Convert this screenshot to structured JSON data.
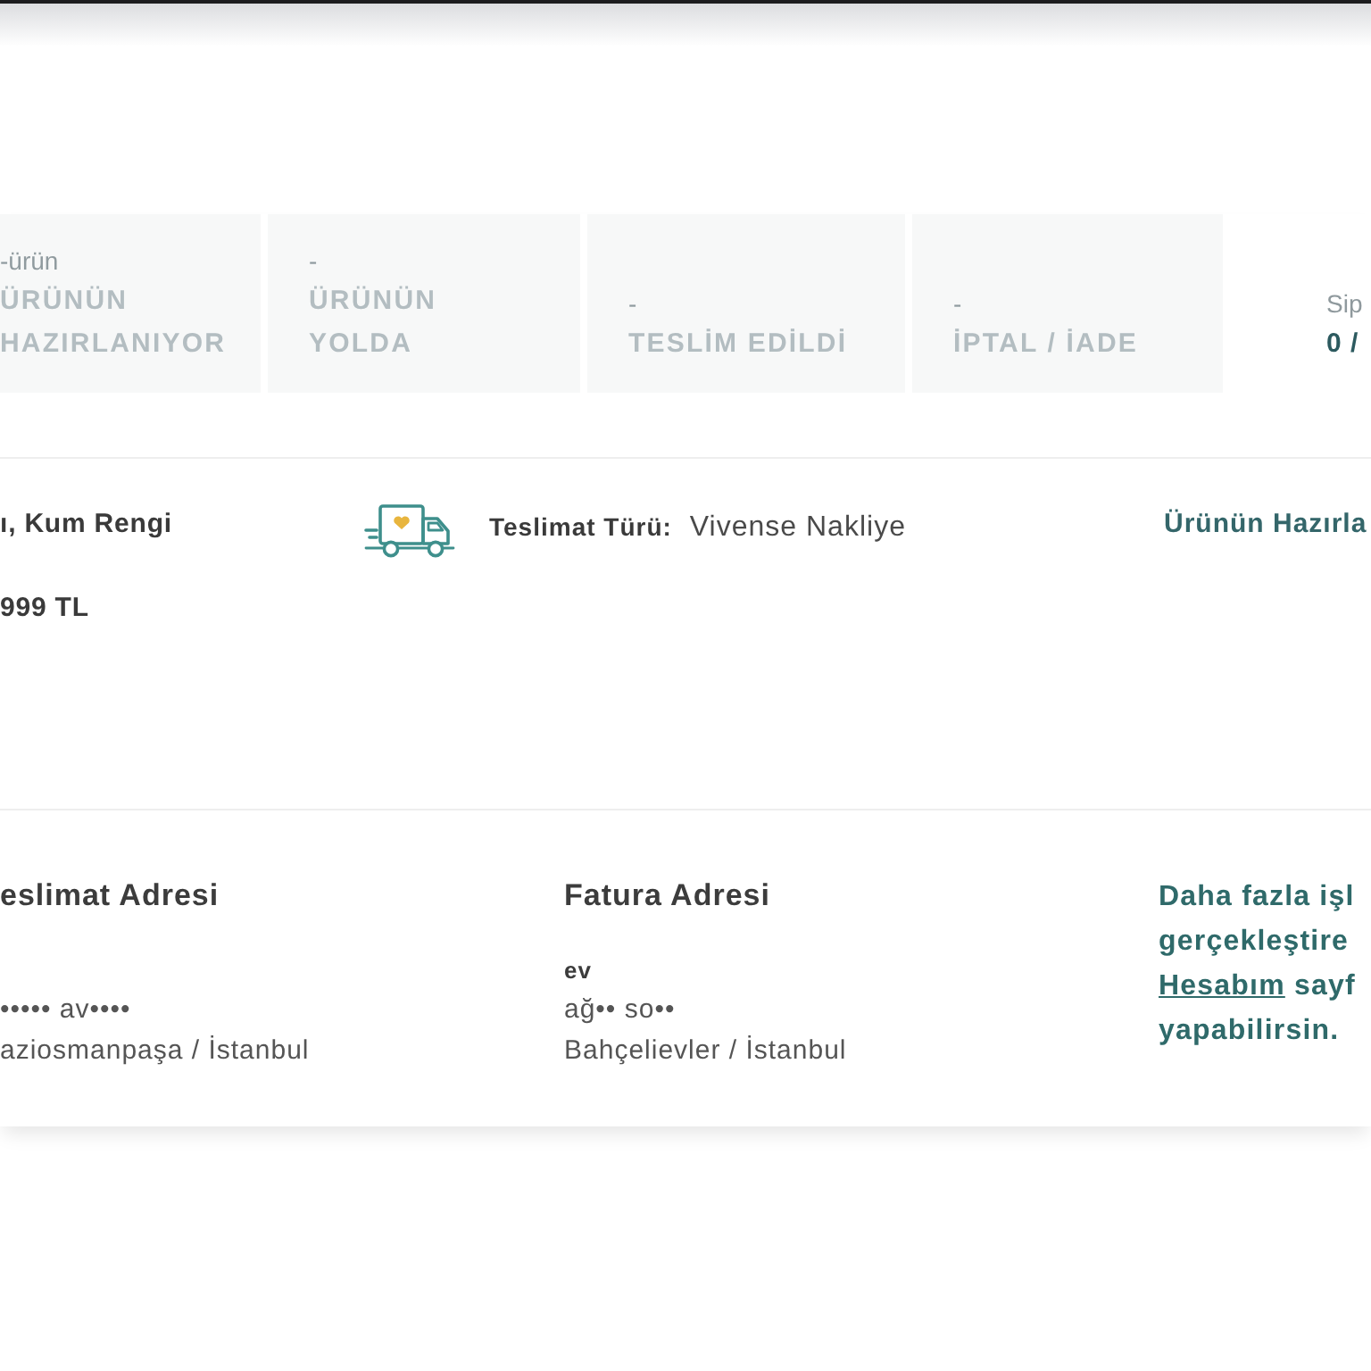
{
  "tabs": [
    {
      "count": "-ürün",
      "label": "ÜRÜNÜN\nHAZIRLANIYOR",
      "selected": false
    },
    {
      "count": "-",
      "label": "ÜRÜNÜN\nYOLDA",
      "selected": false
    },
    {
      "count": "-",
      "label": "TESLİM EDİLDİ",
      "selected": false
    },
    {
      "count": "-",
      "label": "İPTAL / İADE",
      "selected": false
    },
    {
      "count": "Sip",
      "label": "0 /",
      "selected": true
    }
  ],
  "product": {
    "name": "ı, Kum Rengi",
    "price": "999 TL"
  },
  "delivery": {
    "label": "Teslimat Türü:",
    "value": "Vivense Nakliye"
  },
  "order_status": "Ürünün Hazırla",
  "addresses": [
    {
      "title": "eslimat Adresi",
      "lines": [
        "••••• av••••",
        "aziosmanpaşa / İstanbul"
      ]
    },
    {
      "title": "Fatura Adresi",
      "name": "ev",
      "lines": [
        "ağ•• so••",
        "Bahçelievler / İstanbul"
      ]
    }
  ],
  "help_note": {
    "lines_before": [
      "Daha fazla işl",
      "gerçekleştire"
    ],
    "link": "Hesabım",
    "after_link": " sayf",
    "last_line": "yapabilirsin."
  }
}
